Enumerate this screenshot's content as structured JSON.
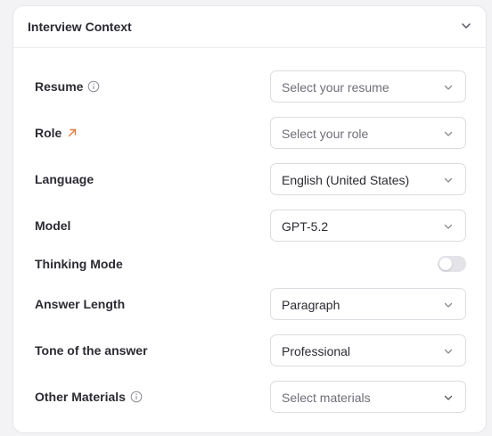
{
  "card": {
    "title": "Interview Context"
  },
  "fields": {
    "resume": {
      "label": "Resume",
      "placeholder": "Select your resume"
    },
    "role": {
      "label": "Role",
      "placeholder": "Select your role"
    },
    "language": {
      "label": "Language",
      "value": "English (United States)"
    },
    "model": {
      "label": "Model",
      "value": "GPT-5.2"
    },
    "thinking_mode": {
      "label": "Thinking Mode",
      "enabled": false
    },
    "answer_length": {
      "label": "Answer Length",
      "value": "Paragraph"
    },
    "tone": {
      "label": "Tone of the answer",
      "value": "Professional"
    },
    "other_materials": {
      "label": "Other Materials",
      "placeholder": "Select materials"
    }
  },
  "icons": {
    "collapse": "chevron-down-icon",
    "info": "info-icon",
    "external_link": "arrow-up-right-icon",
    "dropdown": "chevron-down-icon"
  },
  "colors": {
    "accent": "#e07a3a",
    "text": "#2b2b33",
    "placeholder": "#6e6e78",
    "border": "#dcdce2",
    "toggle_off": "#e3e3e8"
  }
}
